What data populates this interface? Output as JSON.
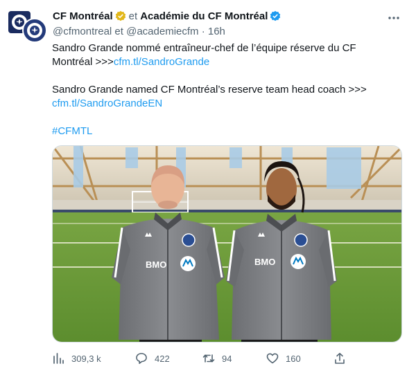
{
  "header": {
    "author1": "CF Montréal",
    "joiner": "et",
    "author2": "Académie du CF Montréal",
    "handles": "@cfmontreal et @academiecfm",
    "dot": "·",
    "time": "16h",
    "more_icon": "more-icon"
  },
  "body": {
    "fr_text": "Sandro Grande nommé entraîneur-chef de l’équipe réserve du CF Montréal >>>",
    "fr_link": "cfm.tl/SandroGrande",
    "en_text": "Sandro Grande named CF Montréal’s reserve team head coach >>>",
    "en_link": "cfm.tl/SandroGrandeEN",
    "hashtag": "#CFMTL"
  },
  "media": {
    "shirt_text_left": "BMO",
    "shirt_text_right": "BMO"
  },
  "actions": {
    "views": "309,3 k",
    "replies": "422",
    "retweets": "94",
    "likes": "160"
  },
  "colors": {
    "link": "#1d9bf0",
    "muted": "#536471",
    "verified_gold": "#e2b719",
    "verified_blue": "#1d9bf0",
    "text": "#0f1419"
  }
}
